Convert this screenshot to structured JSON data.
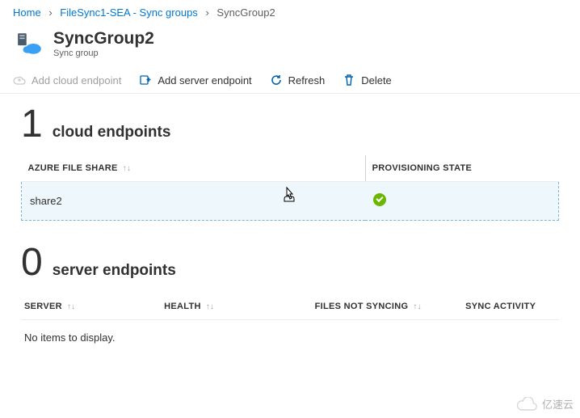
{
  "breadcrumb": {
    "home": "Home",
    "parent": "FileSync1-SEA - Sync groups",
    "current": "SyncGroup2"
  },
  "header": {
    "title": "SyncGroup2",
    "subtitle": "Sync group"
  },
  "toolbar": {
    "add_cloud": "Add cloud endpoint",
    "add_server": "Add server endpoint",
    "refresh": "Refresh",
    "delete": "Delete"
  },
  "cloud": {
    "count": "1",
    "label": "cloud endpoints",
    "cols": {
      "share": "Azure File Share",
      "state": "Provisioning State"
    },
    "rows": [
      {
        "share": "share2",
        "state": "ok"
      }
    ]
  },
  "server": {
    "count": "0",
    "label": "server endpoints",
    "cols": {
      "server": "Server",
      "health": "Health",
      "files": "Files Not Syncing",
      "activity": "Sync Activity"
    },
    "empty": "No items to display."
  },
  "watermark": "亿速云"
}
